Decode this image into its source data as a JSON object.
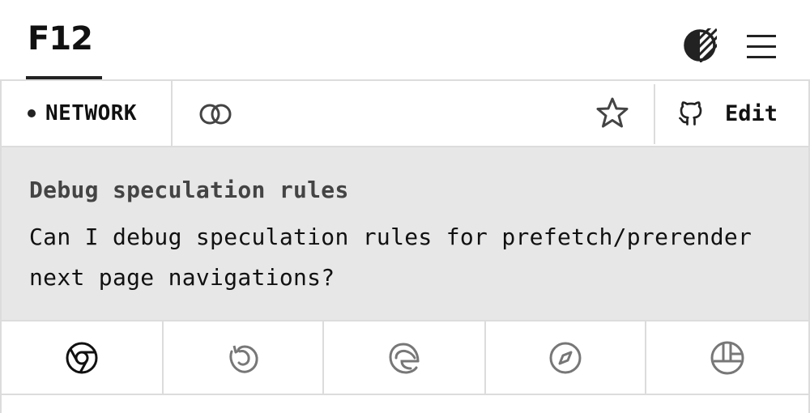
{
  "header": {
    "logo": "F12",
    "theme_icon": "contrast-icon",
    "menu_icon": "hamburger-menu-icon"
  },
  "toolbar": {
    "category_label": "NETWORK",
    "link_icon": "link-icon",
    "favorite_icon": "star-icon",
    "edit_icon": "github-icon",
    "edit_label": "Edit"
  },
  "tip": {
    "title": "Debug speculation rules",
    "description": "Can I debug speculation rules for prefetch/prerender next page navigations?"
  },
  "browsers": [
    {
      "name": "chrome-icon",
      "active": true
    },
    {
      "name": "firefox-icon",
      "active": false
    },
    {
      "name": "edge-icon",
      "active": false
    },
    {
      "name": "safari-icon",
      "active": false
    },
    {
      "name": "polypane-icon",
      "active": false
    }
  ],
  "colors": {
    "active_icon": "#111111",
    "inactive_icon": "#777777",
    "panel_bg": "#e7e7e7",
    "border": "#dcdcdc"
  }
}
